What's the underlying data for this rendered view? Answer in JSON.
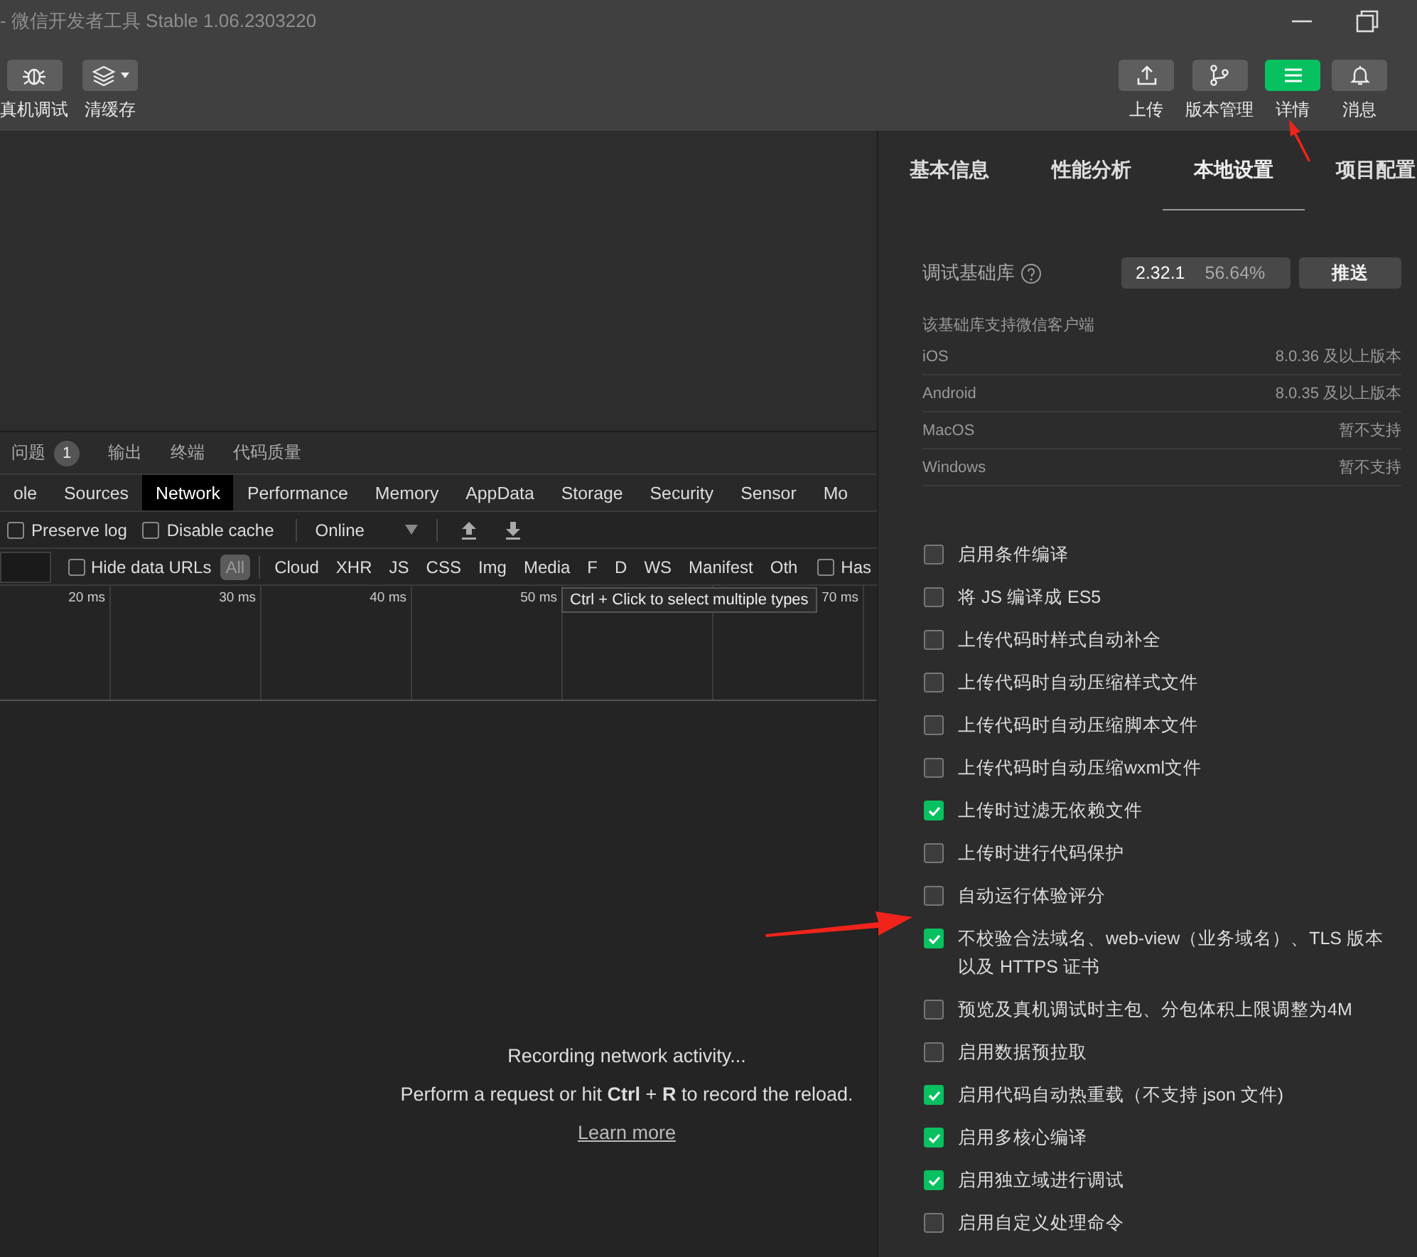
{
  "window": {
    "title": "- 微信开发者工具 Stable 1.06.2303220"
  },
  "toolbar": {
    "left_buttons": [
      {
        "label": "真机调试",
        "kind": "bug"
      },
      {
        "label": "清缓存",
        "kind": "layers"
      }
    ],
    "right_buttons": [
      {
        "label": "上传",
        "kind": "upload",
        "selected": false
      },
      {
        "label": "版本管理",
        "kind": "branch",
        "selected": false
      },
      {
        "label": "详情",
        "kind": "menu",
        "selected": true
      },
      {
        "label": "消息",
        "kind": "bell",
        "selected": false
      }
    ]
  },
  "devtools": {
    "panel_tabs": [
      {
        "label": "问题",
        "badge": "1"
      },
      {
        "label": "输出"
      },
      {
        "label": "终端"
      },
      {
        "label": "代码质量"
      }
    ],
    "tabs": [
      {
        "label": "ole",
        "selected": false
      },
      {
        "label": "Sources",
        "selected": false
      },
      {
        "label": "Network",
        "selected": true
      },
      {
        "label": "Performance",
        "selected": false
      },
      {
        "label": "Memory",
        "selected": false
      },
      {
        "label": "AppData",
        "selected": false
      },
      {
        "label": "Storage",
        "selected": false
      },
      {
        "label": "Security",
        "selected": false
      },
      {
        "label": "Sensor",
        "selected": false
      },
      {
        "label": "Mo",
        "selected": false
      }
    ],
    "network_options": [
      {
        "label": "Preserve log",
        "checked": false
      },
      {
        "label": "Disable cache",
        "checked": false
      }
    ],
    "throttle": "Online",
    "hide_data_urls": {
      "label": "Hide data URLs",
      "checked": false
    },
    "type_filters": [
      {
        "label": "All",
        "selected": true
      },
      {
        "label": "Cloud",
        "selected": false
      },
      {
        "label": "XHR",
        "selected": false
      },
      {
        "label": "JS",
        "selected": false
      },
      {
        "label": "CSS",
        "selected": false
      },
      {
        "label": "Img",
        "selected": false
      },
      {
        "label": "Media",
        "selected": false
      },
      {
        "label": "F",
        "selected": false
      },
      {
        "label": "D",
        "selected": false
      },
      {
        "label": "WS",
        "selected": false
      },
      {
        "label": "Manifest",
        "selected": false
      },
      {
        "label": "Oth",
        "selected": false
      }
    ],
    "has_filter": {
      "label": "Has",
      "checked": false
    },
    "tooltip": "Ctrl + Click to select multiple types",
    "timeline_ticks": [
      "20 ms",
      "30 ms",
      "40 ms",
      "50 ms",
      "70 ms"
    ],
    "empty_state": {
      "title": "Recording network activity...",
      "hint": "Perform a request or hit **Ctrl** + **R** to record the reload.",
      "link": "Learn more"
    }
  },
  "details": {
    "tabs": [
      {
        "label": "基本信息",
        "selected": false
      },
      {
        "label": "性能分析",
        "selected": false
      },
      {
        "label": "本地设置",
        "selected": true
      },
      {
        "label": "项目配置",
        "selected": false
      }
    ],
    "base_library": {
      "label": "调试基础库",
      "version": "2.32.1",
      "usage": "56.64%",
      "push_button": "推送"
    },
    "support": {
      "title": "该基础库支持微信客户端",
      "rows": [
        {
          "platform": "iOS",
          "requirement": "8.0.36 及以上版本"
        },
        {
          "platform": "Android",
          "requirement": "8.0.35 及以上版本"
        },
        {
          "platform": "MacOS",
          "requirement": "暂不支持"
        },
        {
          "platform": "Windows",
          "requirement": "暂不支持"
        }
      ]
    },
    "settings": [
      {
        "label": "启用条件编译",
        "checked": false
      },
      {
        "label": "将 JS 编译成 ES5",
        "checked": false
      },
      {
        "label": "上传代码时样式自动补全",
        "checked": false
      },
      {
        "label": "上传代码时自动压缩样式文件",
        "checked": false
      },
      {
        "label": "上传代码时自动压缩脚本文件",
        "checked": false
      },
      {
        "label": "上传代码时自动压缩wxml文件",
        "checked": false
      },
      {
        "label": "上传时过滤无依赖文件",
        "checked": true
      },
      {
        "label": "上传时进行代码保护",
        "checked": false
      },
      {
        "label": "自动运行体验评分",
        "checked": false
      },
      {
        "label": "不校验合法域名、web-view（业务域名）、TLS 版本以及 HTTPS 证书",
        "checked": true
      },
      {
        "label": "预览及真机调试时主包、分包体积上限调整为4M",
        "checked": false
      },
      {
        "label": "启用数据预拉取",
        "checked": false
      },
      {
        "label": "启用代码自动热重载（不支持 json 文件)",
        "checked": true
      },
      {
        "label": "启用多核心编译",
        "checked": true
      },
      {
        "label": "启用独立域进行调试",
        "checked": true
      },
      {
        "label": "启用自定义处理命令",
        "checked": false
      }
    ]
  }
}
